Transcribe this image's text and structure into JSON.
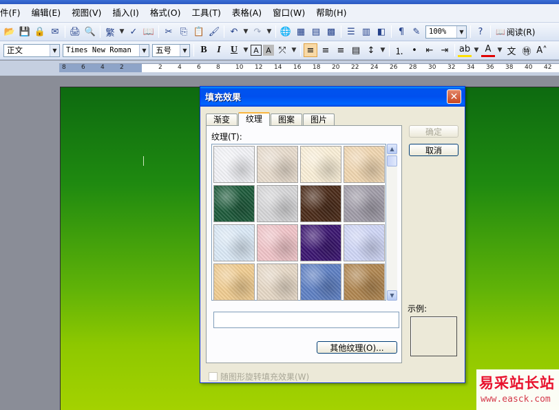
{
  "menu": {
    "items": [
      "件(F)",
      "编辑(E)",
      "视图(V)",
      "插入(I)",
      "格式(O)",
      "工具(T)",
      "表格(A)",
      "窗口(W)",
      "帮助(H)"
    ]
  },
  "toolbar": {
    "zoom": "100%",
    "read_label": "阅读(R)"
  },
  "formatting": {
    "style": "正文",
    "font": "Times New Roman",
    "size": "五号",
    "bold": "B",
    "italic": "I",
    "underline": "U"
  },
  "ruler": {
    "numbers": [
      "8",
      "6",
      "4",
      "2",
      "",
      "2",
      "4",
      "6",
      "8",
      "10",
      "12",
      "14",
      "16",
      "18",
      "20",
      "22",
      "24",
      "26",
      "28",
      "30",
      "32",
      "34",
      "36",
      "38",
      "40",
      "42"
    ]
  },
  "dialog": {
    "title": "填充效果",
    "close_glyph": "✕",
    "tabs": [
      "渐变",
      "纹理",
      "图案",
      "图片"
    ],
    "active_tab": "纹理",
    "texture_label": "纹理(T):",
    "textures": [
      {
        "name": "white-crumpled",
        "color": "#f2f3f7"
      },
      {
        "name": "beige-fabric",
        "color": "#e8dccd"
      },
      {
        "name": "cream-paper",
        "color": "#faefd7"
      },
      {
        "name": "light-sand",
        "color": "#f0d6b0"
      },
      {
        "name": "green-marble",
        "color": "#1d5a3a"
      },
      {
        "name": "white-marble",
        "color": "#d6d6d8"
      },
      {
        "name": "brown-marble",
        "color": "#4a2a18"
      },
      {
        "name": "granite",
        "color": "#a09ca8"
      },
      {
        "name": "blue-tissue",
        "color": "#dbe9f6"
      },
      {
        "name": "pink-tissue",
        "color": "#f0c4c8"
      },
      {
        "name": "purple-mesh",
        "color": "#3a1570"
      },
      {
        "name": "bouquet",
        "color": "#cfd6f6"
      },
      {
        "name": "papyrus",
        "color": "#f0cc90"
      },
      {
        "name": "canvas",
        "color": "#e6d8c6"
      },
      {
        "name": "denim",
        "color": "#5d7fc3"
      },
      {
        "name": "woven-mat",
        "color": "#b08650"
      }
    ],
    "texture_name_value": "",
    "ok_label": "确定",
    "cancel_label": "取消",
    "more_textures_label": "其他纹理(O)...",
    "sample_label": "示例:",
    "rotate_label": "随图形旋转填充效果(W)"
  },
  "watermark": {
    "site_name": "易采站长站",
    "url": "www.easck.com"
  }
}
